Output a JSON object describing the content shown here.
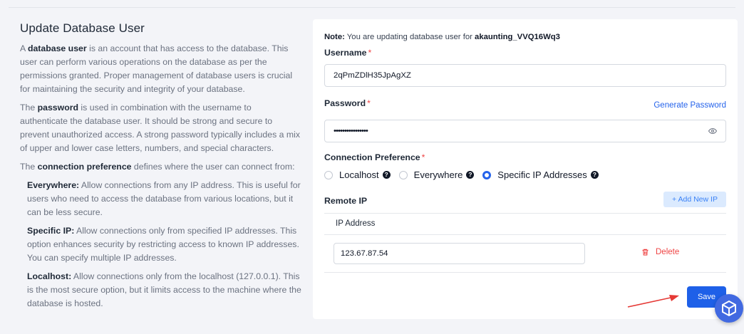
{
  "intro": {
    "title": "Update Database User",
    "p1": [
      "A ",
      "database user",
      " is an account that has access to the database. This user can perform various operations on the database as per the permissions granted. Proper management of database users is crucial for maintaining the security and integrity of your database."
    ],
    "p2": [
      "The ",
      "password",
      " is used in combination with the username to authenticate the database user. It should be strong and secure to prevent unauthorized access. A strong password typically includes a mix of upper and lower case letters, numbers, and special characters."
    ],
    "p3": [
      "The ",
      "connection preference",
      " defines where the user can connect from:"
    ],
    "everywhere": [
      "Everywhere:",
      " Allow connections from any IP address. This is useful for users who need to access the database from various locations, but it can be less secure."
    ],
    "specific": [
      "Specific IP:",
      " Allow connections only from specified IP addresses. This option enhances security by restricting access to known IP addresses. You can specify multiple IP addresses."
    ],
    "localhost": [
      "Localhost:",
      " Allow connections only from the localhost (127.0.0.1). This is the most secure option, but it limits access to the machine where the database is hosted."
    ]
  },
  "form": {
    "note_prefix": "Note:",
    "note_text": " You are updating database user for ",
    "note_db": "akaunting_VVQ16Wq3",
    "required_mark": "*",
    "username_label": "Username",
    "username_value": "2qPmZDlH35JpAgXZ",
    "password_label": "Password",
    "password_value": "••••••••••••••••",
    "generate_password": "Generate Password",
    "connection_label": "Connection Preference",
    "connection_options": [
      "Localhost",
      "Everywhere",
      "Specific IP Addresses"
    ],
    "connection_selected": "Specific IP Addresses",
    "help_glyph": "?",
    "remote_ip_label": "Remote IP",
    "add_new_ip": "+ Add New IP",
    "ip_column_header": "IP Address",
    "ip_rows": [
      "123.67.87.54"
    ],
    "delete_label": "Delete",
    "save_label": "Save"
  },
  "colors": {
    "accent": "#1e60e8",
    "danger": "#ef4444",
    "link": "#2563eb",
    "annotation_arrow": "#e53935"
  }
}
